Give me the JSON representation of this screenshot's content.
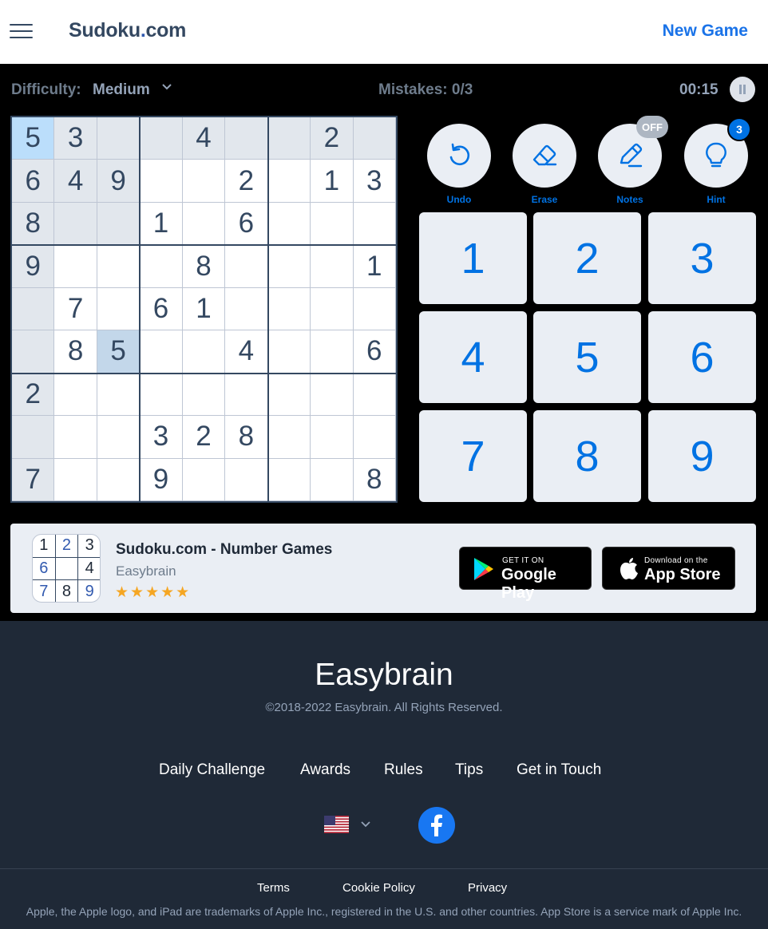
{
  "header": {
    "logo_main": "Sudoku",
    "logo_dot": ".",
    "logo_tld": "com",
    "new_game": "New Game"
  },
  "game": {
    "difficulty_label": "Difficulty:",
    "difficulty_value": "Medium",
    "mistakes": "Mistakes: 0/3",
    "timer": "00:15",
    "selected_cell": [
      0,
      0
    ],
    "board": [
      [
        "5",
        "3",
        "",
        "",
        "4",
        "",
        "",
        "2",
        ""
      ],
      [
        "6",
        "4",
        "9",
        "",
        "",
        "2",
        "",
        "1",
        "3"
      ],
      [
        "8",
        "",
        "",
        "1",
        "",
        "6",
        "",
        "",
        ""
      ],
      [
        "9",
        "",
        "",
        "",
        "8",
        "",
        "",
        "",
        "1"
      ],
      [
        "",
        "7",
        "",
        "6",
        "1",
        "",
        "",
        "",
        ""
      ],
      [
        "",
        "8",
        "5",
        "",
        "",
        "4",
        "",
        "",
        "6"
      ],
      [
        "2",
        "",
        "",
        "",
        "",
        "",
        "",
        "",
        ""
      ],
      [
        "",
        "",
        "",
        "3",
        "2",
        "8",
        "",
        "",
        ""
      ],
      [
        "7",
        "",
        "",
        "9",
        "",
        "",
        "",
        "",
        "8"
      ]
    ]
  },
  "tools": {
    "undo": "Undo",
    "erase": "Erase",
    "notes": "Notes",
    "notes_state": "OFF",
    "hint": "Hint",
    "hint_count": "3"
  },
  "numpad": [
    "1",
    "2",
    "3",
    "4",
    "5",
    "6",
    "7",
    "8",
    "9"
  ],
  "banner": {
    "title": "Sudoku.com - Number Games",
    "developer": "Easybrain",
    "stars": "★★★★★",
    "rating": 4.5,
    "icon_digits": [
      "1",
      "2",
      "3",
      "6",
      "",
      "4",
      "7",
      "8",
      "9"
    ],
    "google_small": "GET IT ON",
    "google_big": "Google Play",
    "apple_small": "Download on the",
    "apple_big": "App Store"
  },
  "footer": {
    "brand": "Easybrain",
    "copyright": "©2018-2022 Easybrain. All Rights Reserved.",
    "nav": [
      "Daily Challenge",
      "Awards",
      "Rules",
      "Tips",
      "Get in Touch"
    ],
    "legal": [
      "Terms",
      "Cookie Policy",
      "Privacy"
    ],
    "note": "Apple, the Apple logo, and iPad are trademarks of Apple Inc., registered in the U.S. and other countries. App Store is a service mark of Apple Inc."
  },
  "colors": {
    "accent": "#0072e3",
    "board_text": "#344861",
    "footer_bg": "#1f2937"
  }
}
